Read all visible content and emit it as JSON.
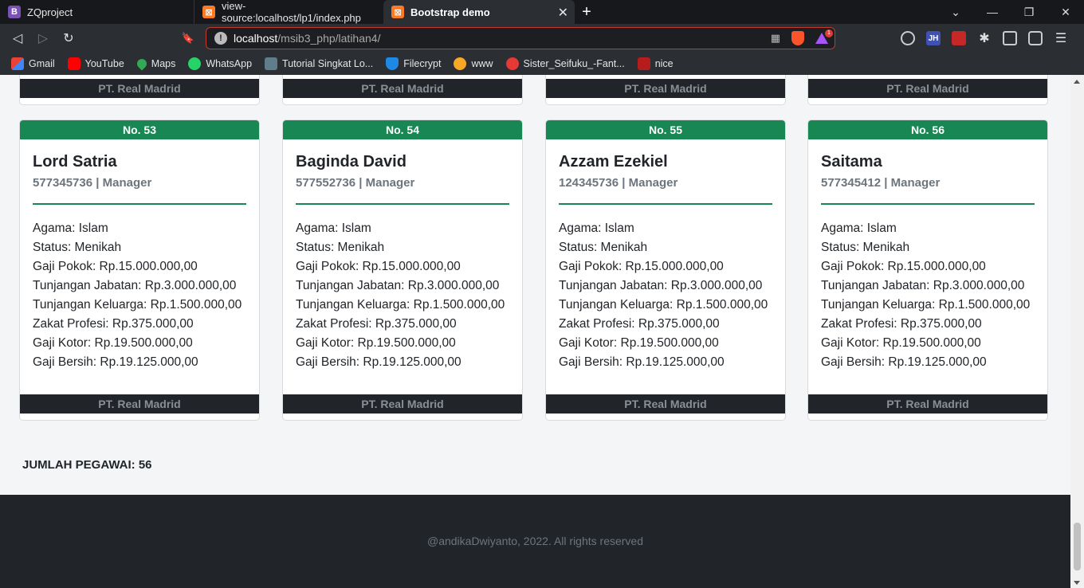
{
  "browser": {
    "tabs": [
      {
        "label": "ZQproject",
        "icon": "B"
      },
      {
        "label": "view-source:localhost/lp1/index.php",
        "icon": "xampp"
      },
      {
        "label": "Bootstrap demo",
        "icon": "xampp",
        "close": "✕"
      }
    ],
    "new_tab": "+",
    "window_controls": {
      "chevron": "⌄",
      "minimize": "—",
      "restore": "❐",
      "close": "✕"
    },
    "nav": {
      "back": "◁",
      "forward": "▷",
      "reload": "↻",
      "bookmark": "🔖"
    },
    "url": {
      "host": "localhost",
      "path": "/msib3_php/latihan4/",
      "info": "!"
    },
    "rewards_count": "1",
    "extensions": {
      "jh": "JH",
      "puzzle": "✱",
      "menu": "☰"
    },
    "bookmarks": [
      "Gmail",
      "YouTube",
      "Maps",
      "WhatsApp",
      "Tutorial Singkat Lo...",
      "Filecrypt",
      "www",
      "Sister_Seifuku_-Fant...",
      "nice"
    ]
  },
  "prev_cards": {
    "footer": "PT. Real Madrid"
  },
  "cards": [
    {
      "number": "No. 53",
      "name": "Lord Satria",
      "nip": "577345736",
      "separator": "|",
      "jabatan": "Manager",
      "details": [
        "Agama: Islam",
        "Status: Menikah",
        "Gaji Pokok: Rp.15.000.000,00",
        "Tunjangan Jabatan: Rp.3.000.000,00",
        "Tunjangan Keluarga: Rp.1.500.000,00",
        "Zakat Profesi: Rp.375.000,00",
        "Gaji Kotor: Rp.19.500.000,00",
        "Gaji Bersih: Rp.19.125.000,00"
      ],
      "footer": "PT. Real Madrid"
    },
    {
      "number": "No. 54",
      "name": "Baginda David",
      "nip": "577552736",
      "separator": "|",
      "jabatan": "Manager",
      "details": [
        "Agama: Islam",
        "Status: Menikah",
        "Gaji Pokok: Rp.15.000.000,00",
        "Tunjangan Jabatan: Rp.3.000.000,00",
        "Tunjangan Keluarga: Rp.1.500.000,00",
        "Zakat Profesi: Rp.375.000,00",
        "Gaji Kotor: Rp.19.500.000,00",
        "Gaji Bersih: Rp.19.125.000,00"
      ],
      "footer": "PT. Real Madrid"
    },
    {
      "number": "No. 55",
      "name": "Azzam Ezekiel",
      "nip": "124345736",
      "separator": "|",
      "jabatan": "Manager",
      "details": [
        "Agama: Islam",
        "Status: Menikah",
        "Gaji Pokok: Rp.15.000.000,00",
        "Tunjangan Jabatan: Rp.3.000.000,00",
        "Tunjangan Keluarga: Rp.1.500.000,00",
        "Zakat Profesi: Rp.375.000,00",
        "Gaji Kotor: Rp.19.500.000,00",
        "Gaji Bersih: Rp.19.125.000,00"
      ],
      "footer": "PT. Real Madrid"
    },
    {
      "number": "No. 56",
      "name": "Saitama",
      "nip": "577345412",
      "separator": "|",
      "jabatan": "Manager",
      "details": [
        "Agama: Islam",
        "Status: Menikah",
        "Gaji Pokok: Rp.15.000.000,00",
        "Tunjangan Jabatan: Rp.3.000.000,00",
        "Tunjangan Keluarga: Rp.1.500.000,00",
        "Zakat Profesi: Rp.375.000,00",
        "Gaji Kotor: Rp.19.500.000,00",
        "Gaji Bersih: Rp.19.125.000,00"
      ],
      "footer": "PT. Real Madrid"
    }
  ],
  "summary": {
    "jumlah_pegawai": "JUMLAH PEGAWAI: 56"
  },
  "footer": {
    "text": "@andikaDwiyanto, 2022. All rights reserved"
  },
  "colors": {
    "header_green": "#198754",
    "card_footer": "#212529",
    "page_footer": "#212529"
  }
}
